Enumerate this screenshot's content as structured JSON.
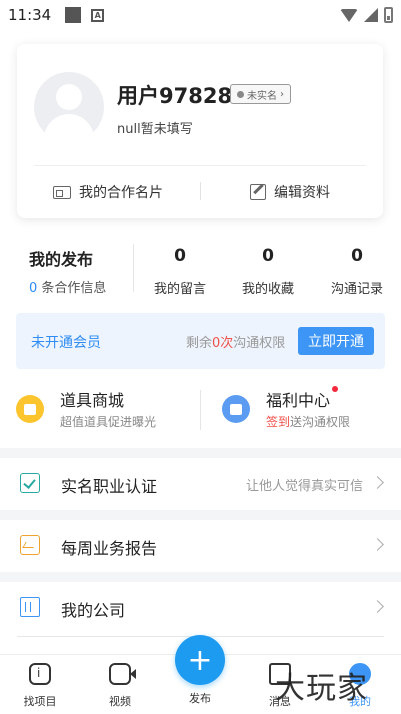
{
  "status_bar": {
    "time": "11:34"
  },
  "profile": {
    "username": "用户97828",
    "verify_badge": "未实名",
    "subtitle": "null暂未填写",
    "actions": {
      "card": "我的合作名片",
      "edit": "编辑资料"
    }
  },
  "stats": {
    "publish_title": "我的发布",
    "publish_count": "0",
    "publish_sub": "条合作信息",
    "items": [
      {
        "value": "0",
        "label": "我的留言"
      },
      {
        "value": "0",
        "label": "我的收藏"
      },
      {
        "value": "0",
        "label": "沟通记录"
      }
    ]
  },
  "vip": {
    "status": "未开通会员",
    "remain_prefix": "剩余",
    "remain_count": "0次",
    "remain_suffix": "沟通权限",
    "button": "立即开通"
  },
  "features": [
    {
      "title": "道具商城",
      "sub": "超值道具促进曝光",
      "icon": "shop-icon",
      "color": "#fcc52e"
    },
    {
      "title": "福利中心",
      "sub_highlight": "签到",
      "sub": "送沟通权限",
      "icon": "gift-icon",
      "color": "#5b9cf2"
    }
  ],
  "menu": [
    {
      "label": "实名职业认证",
      "hint": "让他人觉得真实可信",
      "icon": "verified-check-icon"
    },
    {
      "label": "每周业务报告",
      "hint": "",
      "icon": "report-icon"
    },
    {
      "label": "我的公司",
      "hint": "",
      "icon": "company-icon"
    }
  ],
  "tabbar": {
    "items": [
      {
        "label": "找项目",
        "icon": "find-project-icon"
      },
      {
        "label": "视频",
        "icon": "video-icon"
      },
      {
        "label": "发布",
        "icon": "plus-icon"
      },
      {
        "label": "消息",
        "icon": "message-icon"
      },
      {
        "label": "我的",
        "icon": "profile-icon"
      }
    ],
    "fab_symbol": "+"
  },
  "watermark": "大玩家",
  "colors": {
    "accent": "#3d95f5",
    "alert": "#f0504a",
    "fab": "#1d9bf0"
  }
}
